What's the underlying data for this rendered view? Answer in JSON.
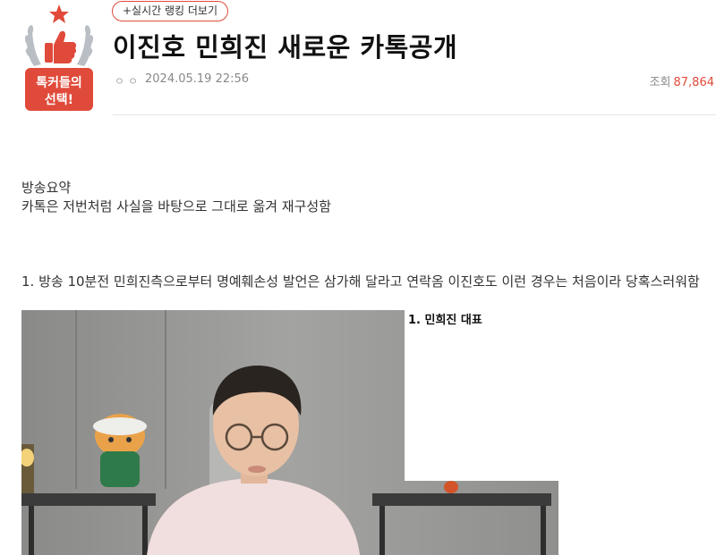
{
  "header": {
    "badge_text_line1": "톡커들의",
    "badge_text_line2": "선택!",
    "ranking_button": "+실시간 랭킹 더보기",
    "title": "이진호 민희진 새로운 카톡공개",
    "author": "ㅇㅇ",
    "date": "2024.05.19 22:56",
    "views_label": "조회",
    "views_count": "87,864"
  },
  "content": {
    "summary_heading": "방송요약",
    "summary_text": "카톡은 저번처럼 사실을 바탕으로 그대로 옮겨 재구성함",
    "point_1": "1. 방송 10분전 민희진측으로부터 명예훼손성 발언은 삼가해 달라고 연락옴 이진호도 이런 경우는 처음이라 당혹스러워함",
    "image_caption": "1. 민희진 대표"
  },
  "colors": {
    "accent": "#e04a3a",
    "badge_laurel": "#b9bec4"
  }
}
